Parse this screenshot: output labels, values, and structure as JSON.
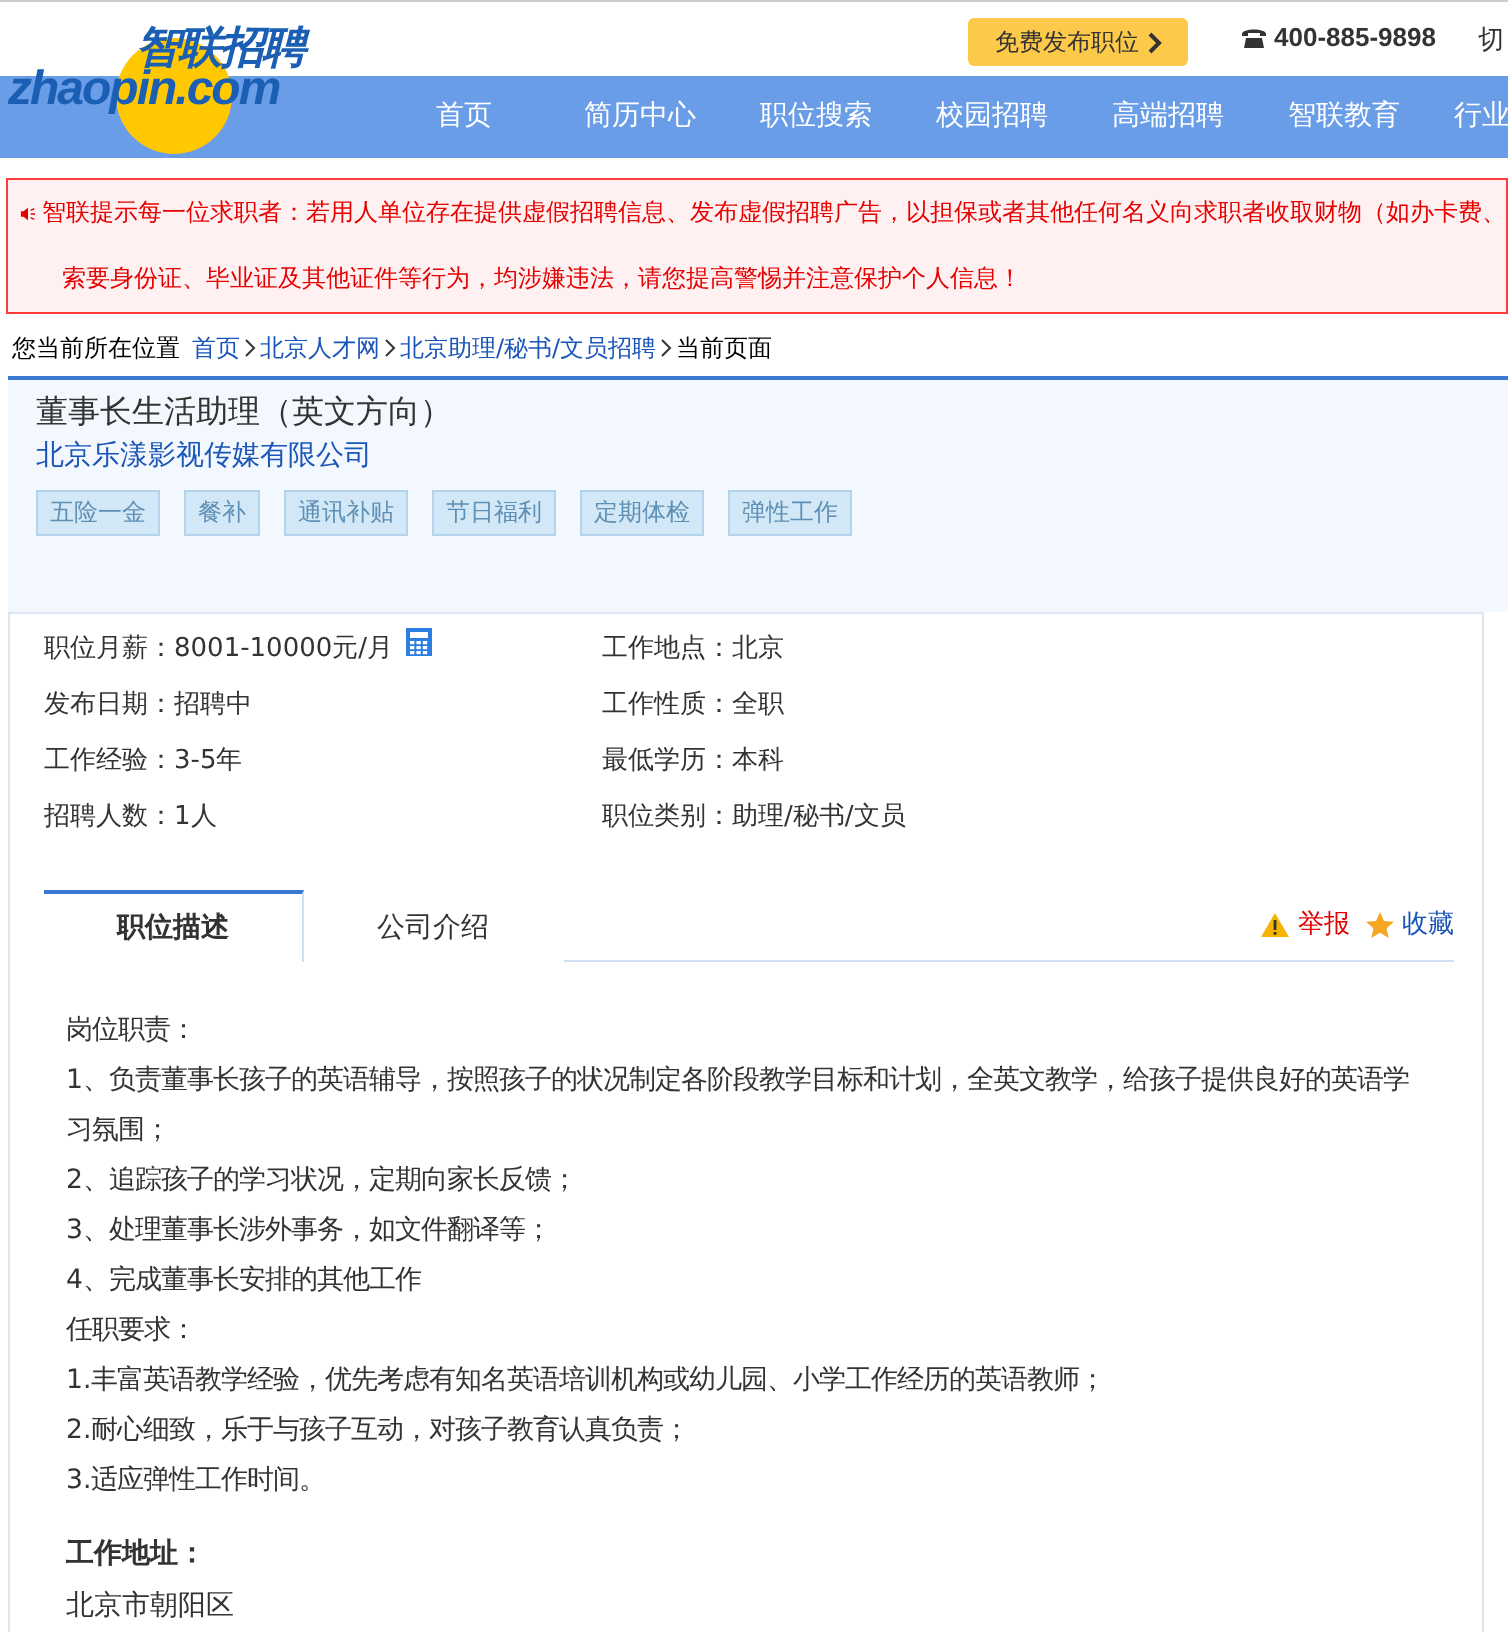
{
  "header": {
    "logo": {
      "title": "智联招聘",
      "domain": "zhaopin.com"
    },
    "post_button": "免费发布职位",
    "phone": "400-885-9898",
    "cut_link": "切"
  },
  "nav": [
    {
      "label": "首页"
    },
    {
      "label": "简历中心"
    },
    {
      "label": "职位搜索"
    },
    {
      "label": "校园招聘"
    },
    {
      "label": "高端招聘"
    },
    {
      "label": "智联教育"
    },
    {
      "label": "行业"
    }
  ],
  "notice": {
    "lines": [
      "智联提示每一位求职者：若用人单位存在提供虚假招聘信息、发布虚假招聘广告，以担保或者其他任何名义向求职者收取财物（如办卡费、",
      "索要身份证、毕业证及其他证件等行为，均涉嫌违法，请您提高警惕并注意保护个人信息！"
    ]
  },
  "breadcrumb": {
    "label": "您当前所在位置",
    "links": [
      "首页",
      "北京人才网",
      "北京助理/秘书/文员招聘"
    ],
    "current": "当前页面"
  },
  "job": {
    "title": "董事长生活助理（英文方向）",
    "company": "北京乐漾影视传媒有限公司",
    "tags": [
      "五险一金",
      "餐补",
      "通讯补贴",
      "节日福利",
      "定期体检",
      "弹性工作"
    ]
  },
  "details": [
    {
      "label": "职位月薪：",
      "value": "8001-10000元/月",
      "kind": "salary"
    },
    {
      "label": "工作地点：",
      "value": "北京",
      "kind": "plain"
    },
    {
      "label": "发布日期：",
      "value": "招聘中",
      "kind": "plain"
    },
    {
      "label": "工作性质：",
      "value": "全职",
      "kind": "plain"
    },
    {
      "label": "工作经验：",
      "value": "3-5年",
      "kind": "plain"
    },
    {
      "label": "最低学历：",
      "value": "本科",
      "kind": "plain"
    },
    {
      "label": "招聘人数：",
      "value": "1人",
      "kind": "plain"
    },
    {
      "label": "职位类别：",
      "value": "助理/秘书/文员",
      "kind": "plain"
    }
  ],
  "tabs": [
    {
      "label": "职位描述",
      "selected": true
    },
    {
      "label": "公司介绍",
      "selected": false
    }
  ],
  "actions": {
    "report": "举报",
    "favorite": "收藏"
  },
  "description": [
    "岗位职责：",
    "1、负责董事长孩子的英语辅导，按照孩子的状况制定各阶段教学目标和计划，全英文教学，给孩子提供良好的英语学习氛围；",
    "2、追踪孩子的学习状况，定期向家长反馈；",
    "3、处理董事长涉外事务，如文件翻译等；",
    "4、完成董事长安排的其他工作",
    "任职要求：",
    "1.丰富英语教学经验，优先考虑有知名英语培训机构或幼儿园、小学工作经历的英语教师；",
    "2.耐心细致，乐于与孩子互动，对孩子教育认真负责；",
    "3.适应弹性工作时间。"
  ],
  "address": {
    "heading": "工作地址：",
    "value": "北京市朝阳区"
  }
}
